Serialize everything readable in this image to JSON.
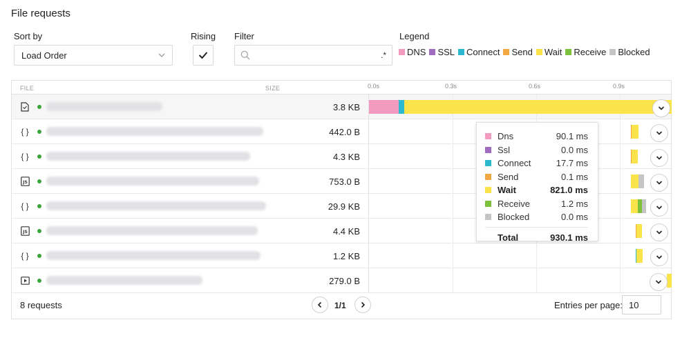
{
  "title": "File requests",
  "controls": {
    "sort_by_label": "Sort by",
    "sort_by_value": "Load Order",
    "rising_label": "Rising",
    "rising_checked": true,
    "filter_label": "Filter",
    "filter_value": "",
    "filter_regex_label": ".*",
    "legend_label": "Legend"
  },
  "legend": [
    {
      "label": "DNS",
      "color": "#f29ac0"
    },
    {
      "label": "SSL",
      "color": "#9f6cbf"
    },
    {
      "label": "Connect",
      "color": "#2cb8cf"
    },
    {
      "label": "Send",
      "color": "#f2a944"
    },
    {
      "label": "Wait",
      "color": "#fbe34c"
    },
    {
      "label": "Receive",
      "color": "#7ec13c"
    },
    {
      "label": "Blocked",
      "color": "#c5c5c5"
    }
  ],
  "table": {
    "headers": {
      "file": "FILE",
      "size": "SIZE"
    },
    "ticks": [
      "0.0s",
      "0.3s",
      "0.6s",
      "0.9s"
    ],
    "rows": [
      {
        "icon": "document-icon",
        "size": "3.8 KB"
      },
      {
        "icon": "braces-icon",
        "size": "442.0 B"
      },
      {
        "icon": "braces-icon",
        "size": "4.3 KB"
      },
      {
        "icon": "js-file-icon",
        "size": "753.0 B"
      },
      {
        "icon": "braces-icon",
        "size": "29.9 KB"
      },
      {
        "icon": "js-file-icon",
        "size": "4.4 KB"
      },
      {
        "icon": "braces-icon",
        "size": "1.2 KB"
      },
      {
        "icon": "video-icon",
        "size": "279.0 B"
      }
    ]
  },
  "tooltip": {
    "rows": [
      {
        "name": "Dns",
        "value": "90.1 ms",
        "color": "#f29ac0"
      },
      {
        "name": "Ssl",
        "value": "0.0 ms",
        "color": "#9f6cbf"
      },
      {
        "name": "Connect",
        "value": "17.7 ms",
        "color": "#2cb8cf"
      },
      {
        "name": "Send",
        "value": "0.1 ms",
        "color": "#f2a944"
      },
      {
        "name": "Wait",
        "value": "821.0 ms",
        "color": "#fbe34c"
      },
      {
        "name": "Receive",
        "value": "1.2 ms",
        "color": "#7ec13c"
      },
      {
        "name": "Blocked",
        "value": "0.0 ms",
        "color": "#c5c5c5"
      }
    ],
    "total_label": "Total",
    "total_value": "930.1 ms"
  },
  "footer": {
    "count": "8 requests",
    "page": "1/1",
    "entries_label": "Entries per page:",
    "entries_value": "10"
  }
}
